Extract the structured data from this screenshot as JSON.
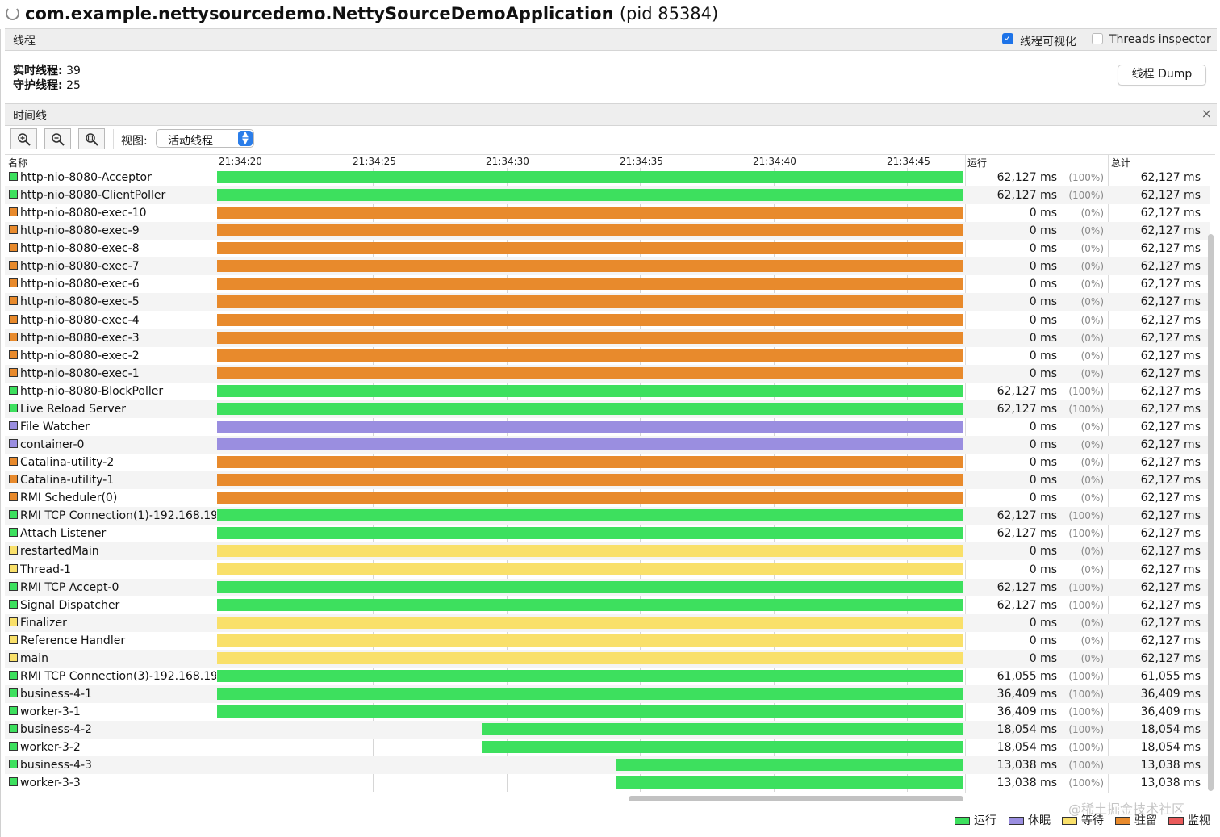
{
  "window": {
    "title": "com.example.nettysourcedemo.NettySourceDemoApplication",
    "pid": "(pid 85384)"
  },
  "threads_panel": {
    "label": "线程",
    "visualize_label": "线程可视化",
    "visualize_checked": true,
    "inspector_label": "Threads inspector",
    "inspector_checked": false,
    "live_label": "实时线程:",
    "live_value": "39",
    "daemon_label": "守护线程:",
    "daemon_value": "25",
    "dump_label": "线程 Dump"
  },
  "timeline_panel": {
    "label": "时间线",
    "close": "×",
    "view_label": "视图:",
    "view_value": "活动线程"
  },
  "table": {
    "col_name": "名称",
    "col_run": "运行",
    "col_total": "总计",
    "ticks": [
      "21:34:20",
      "21:34:25",
      "21:34:30",
      "21:34:35",
      "21:34:40",
      "21:34:45"
    ],
    "rows": [
      {
        "name": "http-nio-8080-Acceptor",
        "state": "running",
        "start": 0,
        "run": "62,127 ms",
        "pct": "(100%)",
        "total": "62,127 ms"
      },
      {
        "name": "http-nio-8080-ClientPoller",
        "state": "running",
        "start": 0,
        "run": "62,127 ms",
        "pct": "(100%)",
        "total": "62,127 ms"
      },
      {
        "name": "http-nio-8080-exec-10",
        "state": "park",
        "start": 0,
        "run": "0 ms",
        "pct": "(0%)",
        "total": "62,127 ms"
      },
      {
        "name": "http-nio-8080-exec-9",
        "state": "park",
        "start": 0,
        "run": "0 ms",
        "pct": "(0%)",
        "total": "62,127 ms"
      },
      {
        "name": "http-nio-8080-exec-8",
        "state": "park",
        "start": 0,
        "run": "0 ms",
        "pct": "(0%)",
        "total": "62,127 ms"
      },
      {
        "name": "http-nio-8080-exec-7",
        "state": "park",
        "start": 0,
        "run": "0 ms",
        "pct": "(0%)",
        "total": "62,127 ms"
      },
      {
        "name": "http-nio-8080-exec-6",
        "state": "park",
        "start": 0,
        "run": "0 ms",
        "pct": "(0%)",
        "total": "62,127 ms"
      },
      {
        "name": "http-nio-8080-exec-5",
        "state": "park",
        "start": 0,
        "run": "0 ms",
        "pct": "(0%)",
        "total": "62,127 ms"
      },
      {
        "name": "http-nio-8080-exec-4",
        "state": "park",
        "start": 0,
        "run": "0 ms",
        "pct": "(0%)",
        "total": "62,127 ms"
      },
      {
        "name": "http-nio-8080-exec-3",
        "state": "park",
        "start": 0,
        "run": "0 ms",
        "pct": "(0%)",
        "total": "62,127 ms"
      },
      {
        "name": "http-nio-8080-exec-2",
        "state": "park",
        "start": 0,
        "run": "0 ms",
        "pct": "(0%)",
        "total": "62,127 ms"
      },
      {
        "name": "http-nio-8080-exec-1",
        "state": "park",
        "start": 0,
        "run": "0 ms",
        "pct": "(0%)",
        "total": "62,127 ms"
      },
      {
        "name": "http-nio-8080-BlockPoller",
        "state": "running",
        "start": 0,
        "run": "62,127 ms",
        "pct": "(100%)",
        "total": "62,127 ms"
      },
      {
        "name": "Live Reload Server",
        "state": "running",
        "start": 0,
        "run": "62,127 ms",
        "pct": "(100%)",
        "total": "62,127 ms"
      },
      {
        "name": "File Watcher",
        "state": "sleep",
        "start": 0,
        "run": "0 ms",
        "pct": "(0%)",
        "total": "62,127 ms"
      },
      {
        "name": "container-0",
        "state": "sleep",
        "start": 0,
        "run": "0 ms",
        "pct": "(0%)",
        "total": "62,127 ms"
      },
      {
        "name": "Catalina-utility-2",
        "state": "park",
        "start": 0,
        "run": "0 ms",
        "pct": "(0%)",
        "total": "62,127 ms"
      },
      {
        "name": "Catalina-utility-1",
        "state": "park",
        "start": 0,
        "run": "0 ms",
        "pct": "(0%)",
        "total": "62,127 ms"
      },
      {
        "name": "RMI Scheduler(0)",
        "state": "park",
        "start": 0,
        "run": "0 ms",
        "pct": "(0%)",
        "total": "62,127 ms"
      },
      {
        "name": "RMI TCP Connection(1)-192.168.19",
        "state": "running",
        "start": 0,
        "run": "62,127 ms",
        "pct": "(100%)",
        "total": "62,127 ms"
      },
      {
        "name": "Attach Listener",
        "state": "running",
        "start": 0,
        "run": "62,127 ms",
        "pct": "(100%)",
        "total": "62,127 ms"
      },
      {
        "name": "restartedMain",
        "state": "wait",
        "start": 0,
        "run": "0 ms",
        "pct": "(0%)",
        "total": "62,127 ms"
      },
      {
        "name": "Thread-1",
        "state": "wait",
        "start": 0,
        "run": "0 ms",
        "pct": "(0%)",
        "total": "62,127 ms"
      },
      {
        "name": "RMI TCP Accept-0",
        "state": "running",
        "start": 0,
        "run": "62,127 ms",
        "pct": "(100%)",
        "total": "62,127 ms"
      },
      {
        "name": "Signal Dispatcher",
        "state": "running",
        "start": 0,
        "run": "62,127 ms",
        "pct": "(100%)",
        "total": "62,127 ms"
      },
      {
        "name": "Finalizer",
        "state": "wait",
        "start": 0,
        "run": "0 ms",
        "pct": "(0%)",
        "total": "62,127 ms"
      },
      {
        "name": "Reference Handler",
        "state": "wait",
        "start": 0,
        "run": "0 ms",
        "pct": "(0%)",
        "total": "62,127 ms"
      },
      {
        "name": "main",
        "state": "wait",
        "start": 0,
        "run": "0 ms",
        "pct": "(0%)",
        "total": "62,127 ms"
      },
      {
        "name": "RMI TCP Connection(3)-192.168.19",
        "state": "running",
        "start": 0,
        "run": "61,055 ms",
        "pct": "(100%)",
        "total": "61,055 ms"
      },
      {
        "name": "business-4-1",
        "state": "running",
        "start": 0,
        "run": "36,409 ms",
        "pct": "(100%)",
        "total": "36,409 ms"
      },
      {
        "name": "worker-3-1",
        "state": "running",
        "start": 0,
        "run": "36,409 ms",
        "pct": "(100%)",
        "total": "36,409 ms"
      },
      {
        "name": "business-4-2",
        "state": "running",
        "start": 0.355,
        "run": "18,054 ms",
        "pct": "(100%)",
        "total": "18,054 ms"
      },
      {
        "name": "worker-3-2",
        "state": "running",
        "start": 0.355,
        "run": "18,054 ms",
        "pct": "(100%)",
        "total": "18,054 ms"
      },
      {
        "name": "business-4-3",
        "state": "running",
        "start": 0.534,
        "run": "13,038 ms",
        "pct": "(100%)",
        "total": "13,038 ms"
      },
      {
        "name": "worker-3-3",
        "state": "running",
        "start": 0.534,
        "run": "13,038 ms",
        "pct": "(100%)",
        "total": "13,038 ms"
      }
    ]
  },
  "state_colors": {
    "running": "#3de05e",
    "sleep": "#9a8ee0",
    "wait": "#f9e06a",
    "park": "#e88a2c",
    "monitor": "#ea5b5b"
  },
  "legend": [
    {
      "state": "running",
      "label": "运行"
    },
    {
      "state": "sleep",
      "label": "休眠"
    },
    {
      "state": "wait",
      "label": "等待"
    },
    {
      "state": "park",
      "label": "驻留"
    },
    {
      "state": "monitor",
      "label": "监视"
    }
  ],
  "watermark": "@稀土掘金技术社区"
}
